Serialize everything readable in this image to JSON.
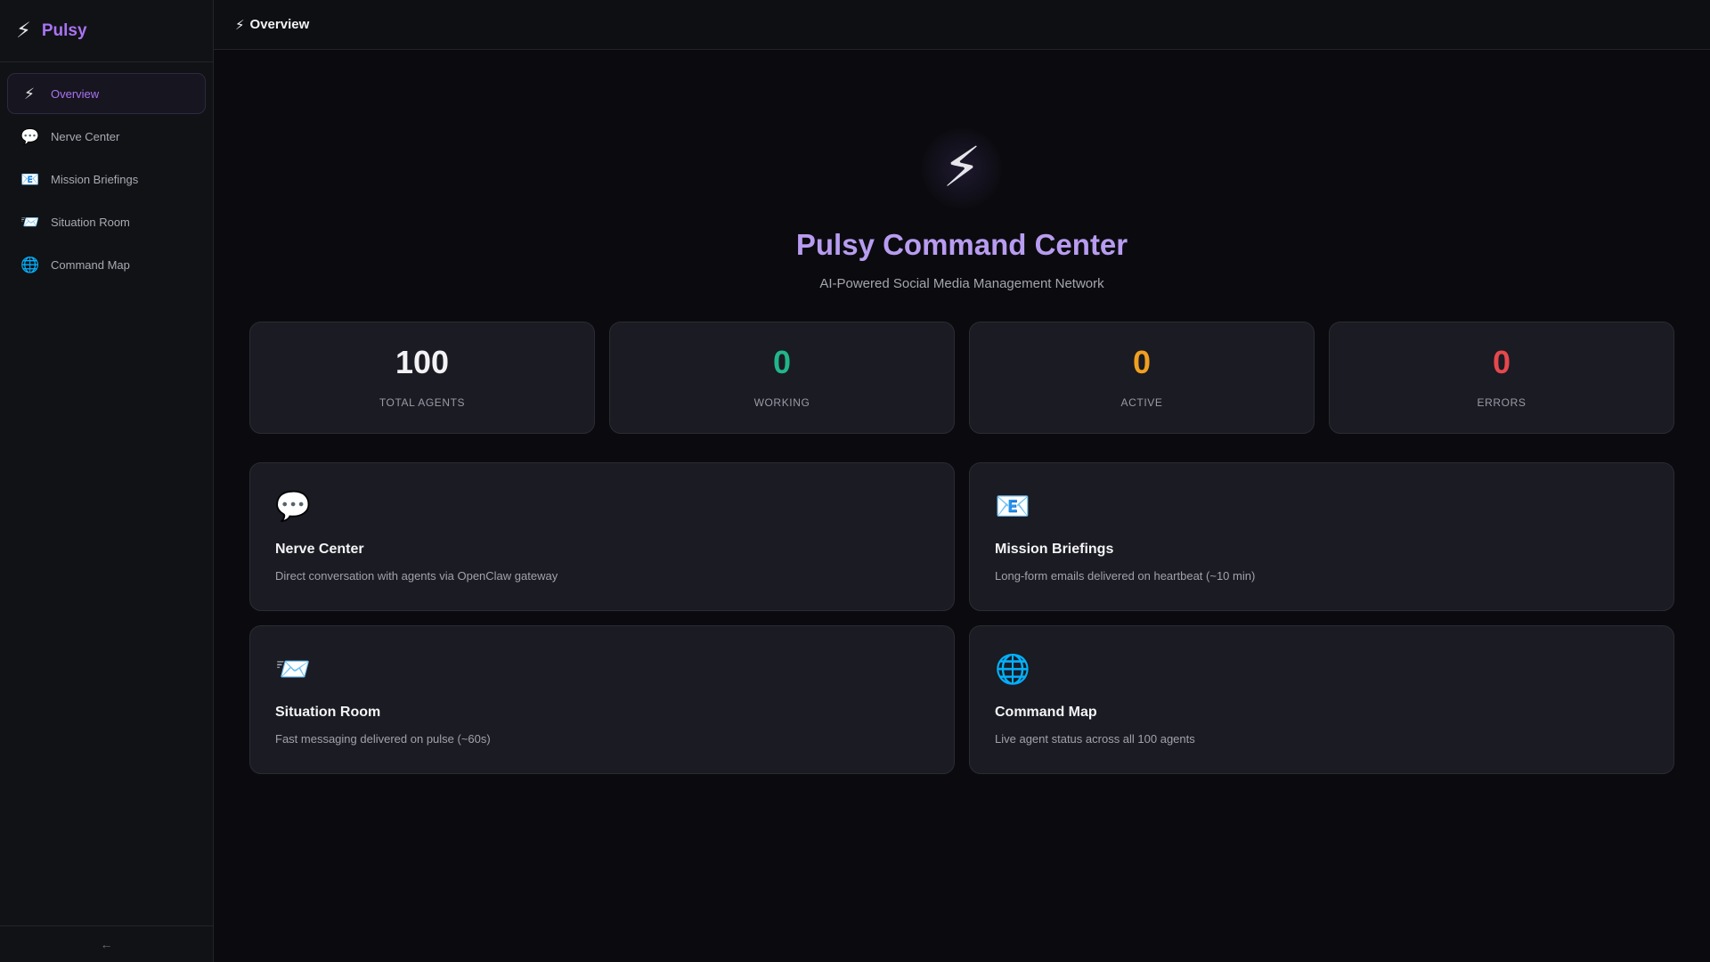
{
  "brand": {
    "icon": "lightning-icon",
    "glyph": "⚡",
    "name": "Pulsy"
  },
  "sidebar": {
    "items": [
      {
        "label": "Overview",
        "icon": "lightning-icon",
        "glyph": "⚡",
        "active": true
      },
      {
        "label": "Nerve Center",
        "icon": "speech-bubble-icon",
        "glyph": "💬",
        "active": false
      },
      {
        "label": "Mission Briefings",
        "icon": "email-icon",
        "glyph": "📧",
        "active": false
      },
      {
        "label": "Situation Room",
        "icon": "incoming-envelope-icon",
        "glyph": "📨",
        "active": false
      },
      {
        "label": "Command Map",
        "icon": "globe-icon",
        "glyph": "🌐",
        "active": false
      }
    ],
    "collapse_glyph": "←"
  },
  "topbar": {
    "glyph": "⚡",
    "title": "Overview"
  },
  "hero": {
    "glyph": "⚡",
    "title": "Pulsy Command Center",
    "subtitle": "AI-Powered Social Media Management Network"
  },
  "stats": [
    {
      "value": "100",
      "label": "TOTAL AGENTS",
      "color": "#f2f2f4"
    },
    {
      "value": "0",
      "label": "WORKING",
      "color": "#22b58a"
    },
    {
      "value": "0",
      "label": "ACTIVE",
      "color": "#f0a020"
    },
    {
      "value": "0",
      "label": "ERRORS",
      "color": "#e5484d"
    }
  ],
  "cards": [
    {
      "glyph": "💬",
      "icon": "speech-bubble-icon",
      "title": "Nerve Center",
      "description": "Direct conversation with agents via OpenClaw gateway"
    },
    {
      "glyph": "📧",
      "icon": "email-icon",
      "title": "Mission Briefings",
      "description": "Long-form emails delivered on heartbeat (~10 min)"
    },
    {
      "glyph": "📨",
      "icon": "incoming-envelope-icon",
      "title": "Situation Room",
      "description": "Fast messaging delivered on pulse (~60s)"
    },
    {
      "glyph": "🌐",
      "icon": "globe-icon",
      "title": "Command Map",
      "description": "Live agent status across all 100 agents"
    }
  ]
}
